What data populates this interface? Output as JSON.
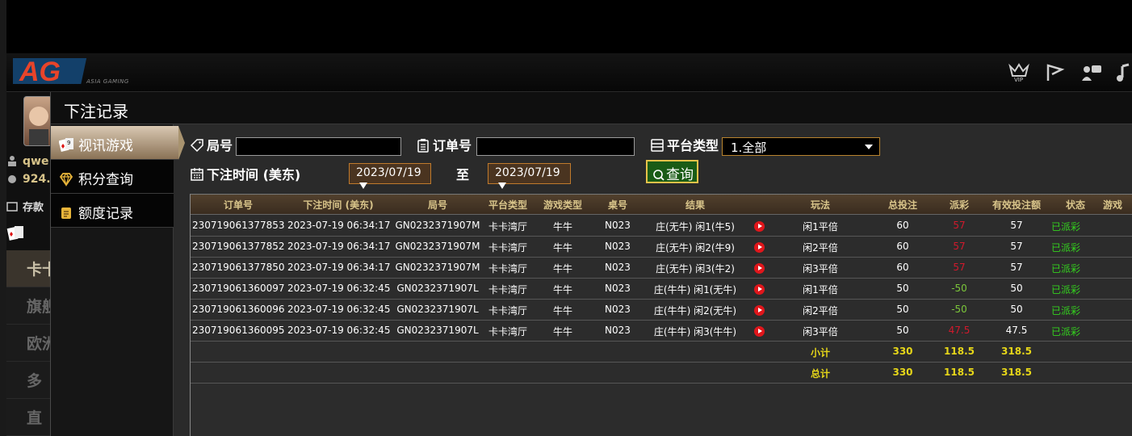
{
  "app": {
    "logo_text": "AG",
    "logo_sub": "ASIA GAMING",
    "header_icons": [
      "vip-icon",
      "flag-icon",
      "chat-icon",
      "music-icon"
    ],
    "user": {
      "name": "qwe",
      "balance": "924."
    },
    "side_links": [
      "存款"
    ],
    "tabs": [
      "卡卡",
      "旗舰",
      "欧洲",
      "多",
      "直"
    ]
  },
  "modal": {
    "title": "下注记录",
    "menu": [
      {
        "label": "视讯游戏",
        "icon": "cards-icon",
        "active": true
      },
      {
        "label": "积分查询",
        "icon": "diamond-icon",
        "active": false
      },
      {
        "label": "额度记录",
        "icon": "note-icon",
        "active": false
      }
    ],
    "filters": {
      "round_label": "局号",
      "round_value": "",
      "order_label": "订单号",
      "order_value": "",
      "platform_label": "平台类型",
      "platform_value": "1.全部",
      "time_label": "下注时间 (美东)",
      "date_from": "2023/07/19",
      "to_label": "至",
      "date_to": "2023/07/19",
      "query_label": "查询"
    },
    "table": {
      "headers": [
        "订单号",
        "下注时间 (美东)",
        "局号",
        "平台类型",
        "游戏类型",
        "桌号",
        "结果",
        "玩法",
        "总投注",
        "派彩",
        "有效投注额",
        "状态",
        "游戏"
      ],
      "rows": [
        {
          "order": "230719061377853",
          "time": "2023-07-19 06:34:17",
          "round": "GN0232371907M",
          "platform": "卡卡湾厅",
          "game": "牛牛",
          "table": "N023",
          "result": "庄(无牛) 闲1(牛5)",
          "play": "闲1平倍",
          "bet": "60",
          "payout": "57",
          "payout_color": "#d1192c",
          "valid": "57",
          "status": "已派彩"
        },
        {
          "order": "230719061377852",
          "time": "2023-07-19 06:34:17",
          "round": "GN0232371907M",
          "platform": "卡卡湾厅",
          "game": "牛牛",
          "table": "N023",
          "result": "庄(无牛) 闲2(牛9)",
          "play": "闲2平倍",
          "bet": "60",
          "payout": "57",
          "payout_color": "#d1192c",
          "valid": "57",
          "status": "已派彩"
        },
        {
          "order": "230719061377850",
          "time": "2023-07-19 06:34:17",
          "round": "GN0232371907M",
          "platform": "卡卡湾厅",
          "game": "牛牛",
          "table": "N023",
          "result": "庄(无牛) 闲3(牛2)",
          "play": "闲3平倍",
          "bet": "60",
          "payout": "57",
          "payout_color": "#d1192c",
          "valid": "57",
          "status": "已派彩"
        },
        {
          "order": "230719061360097",
          "time": "2023-07-19 06:32:45",
          "round": "GN0232371907L",
          "platform": "卡卡湾厅",
          "game": "牛牛",
          "table": "N023",
          "result": "庄(牛牛) 闲1(无牛)",
          "play": "闲1平倍",
          "bet": "50",
          "payout": "-50",
          "payout_color": "#7cc73a",
          "valid": "50",
          "status": "已派彩"
        },
        {
          "order": "230719061360096",
          "time": "2023-07-19 06:32:45",
          "round": "GN0232371907L",
          "platform": "卡卡湾厅",
          "game": "牛牛",
          "table": "N023",
          "result": "庄(牛牛) 闲2(无牛)",
          "play": "闲2平倍",
          "bet": "50",
          "payout": "-50",
          "payout_color": "#7cc73a",
          "valid": "50",
          "status": "已派彩"
        },
        {
          "order": "230719061360095",
          "time": "2023-07-19 06:32:45",
          "round": "GN0232371907L",
          "platform": "卡卡湾厅",
          "game": "牛牛",
          "table": "N023",
          "result": "庄(牛牛) 闲3(牛牛)",
          "play": "闲3平倍",
          "bet": "50",
          "payout": "47.5",
          "payout_color": "#d1192c",
          "valid": "47.5",
          "status": "已派彩"
        }
      ],
      "subtotal": {
        "label": "小计",
        "bet": "330",
        "payout": "118.5",
        "valid": "318.5"
      },
      "total": {
        "label": "总计",
        "bet": "330",
        "payout": "118.5",
        "valid": "318.5"
      }
    }
  }
}
